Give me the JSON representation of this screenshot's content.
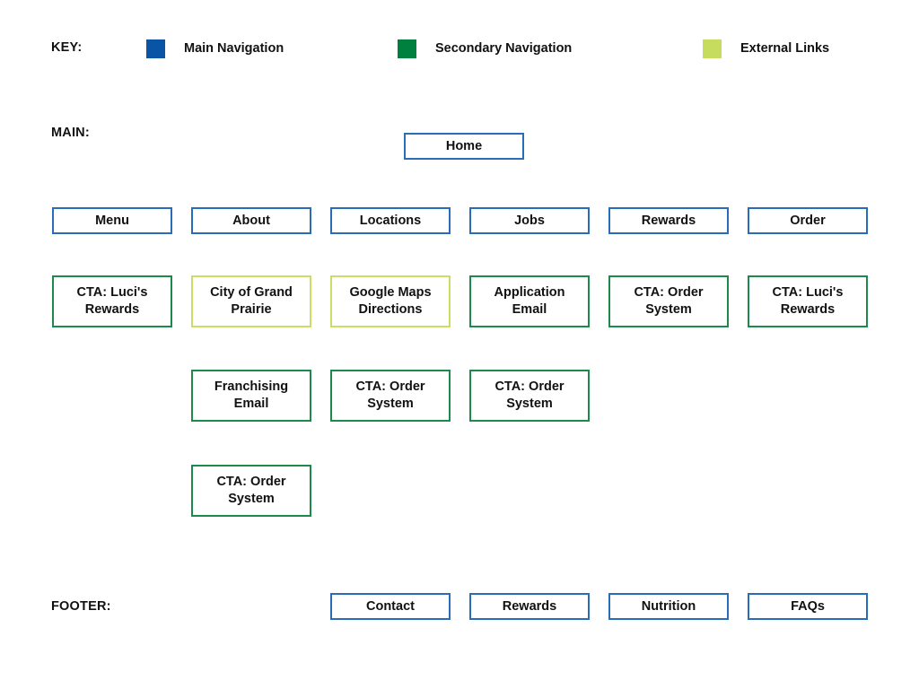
{
  "legend": {
    "label": "KEY:",
    "items": [
      {
        "color": "#0a54a6",
        "label": "Main Navigation",
        "swatch_name": "main-navigation-swatch"
      },
      {
        "color": "#00803f",
        "label": "Secondary Navigation",
        "swatch_name": "secondary-navigation-swatch"
      },
      {
        "color": "#c5dc5e",
        "label": "External Links",
        "swatch_name": "external-links-swatch"
      }
    ]
  },
  "sections": {
    "main_label": "MAIN:",
    "footer_label": "FOOTER:"
  },
  "colors": {
    "main_navigation_border": "#2b6cb8",
    "secondary_navigation_border": "#1b8a4b",
    "external_links_border": "#ccdd66",
    "text": "#111111",
    "background": "#ffffff"
  },
  "home": {
    "label": "Home",
    "type": "main"
  },
  "nav_row": [
    {
      "label": "Menu",
      "type": "main"
    },
    {
      "label": "About",
      "type": "main"
    },
    {
      "label": "Locations",
      "type": "main"
    },
    {
      "label": "Jobs",
      "type": "main"
    },
    {
      "label": "Rewards",
      "type": "main"
    },
    {
      "label": "Order",
      "type": "main"
    }
  ],
  "sub_row_1": [
    {
      "label": "CTA: Luci's\nRewards",
      "type": "secondary"
    },
    {
      "label": "City of Grand\nPrairie",
      "type": "external"
    },
    {
      "label": "Google Maps\nDirections",
      "type": "external"
    },
    {
      "label": "Application\nEmail",
      "type": "secondary"
    },
    {
      "label": "CTA: Order\nSystem",
      "type": "secondary"
    },
    {
      "label": "CTA: Luci's\nRewards",
      "type": "secondary"
    }
  ],
  "sub_row_2": [
    {
      "label": "Franchising\nEmail",
      "type": "secondary",
      "column": 2
    },
    {
      "label": "CTA: Order\nSystem",
      "type": "secondary",
      "column": 3
    },
    {
      "label": "CTA: Order\nSystem",
      "type": "secondary",
      "column": 4
    }
  ],
  "sub_row_3": [
    {
      "label": "CTA: Order\nSystem",
      "type": "secondary",
      "column": 2
    }
  ],
  "footer_row": [
    {
      "label": "Contact",
      "type": "main",
      "column": 3
    },
    {
      "label": "Rewards",
      "type": "main",
      "column": 4
    },
    {
      "label": "Nutrition",
      "type": "main",
      "column": 5
    },
    {
      "label": "FAQs",
      "type": "main",
      "column": 6
    }
  ]
}
